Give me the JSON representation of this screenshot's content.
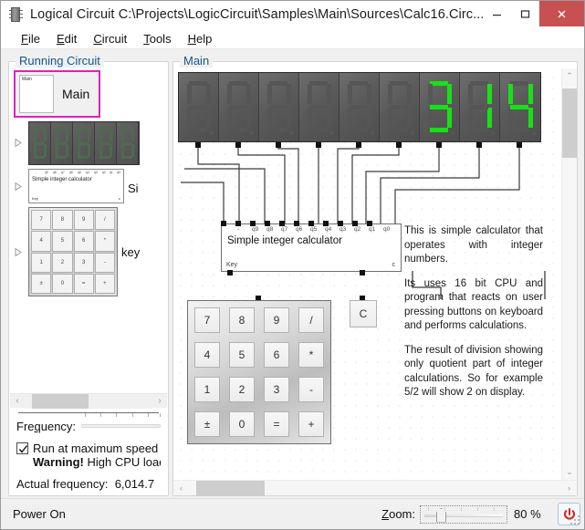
{
  "window": {
    "title": "Logical Circuit C:\\Projects\\LogicCircuit\\Samples\\Main\\Sources\\Calc16.Circ...",
    "icon": "chip-icon",
    "minimize_label": "–",
    "maximize_label": "□",
    "close_label": "×",
    "accent_close": "#c75050",
    "accent_selection": "#e020c0",
    "accent_groupbox_title": "#14568c"
  },
  "menu": {
    "items": [
      {
        "label": "File",
        "accel": "F"
      },
      {
        "label": "Edit",
        "accel": "E"
      },
      {
        "label": "Circuit",
        "accel": "C"
      },
      {
        "label": "Tools",
        "accel": "T"
      },
      {
        "label": "Help",
        "accel": "H"
      }
    ]
  },
  "sidebar": {
    "group_title": "Running Circuit",
    "items": [
      {
        "name": "Main",
        "label": "Main",
        "thumb_label": "Main",
        "selected": true,
        "expandable": false
      },
      {
        "name": "seven-segment-display",
        "label": "",
        "selected": false,
        "expandable": true
      },
      {
        "name": "simple-integer-calculator",
        "label": "Si",
        "selected": false,
        "expandable": true
      },
      {
        "name": "keypad",
        "label": "key",
        "selected": false,
        "expandable": true
      }
    ],
    "hscroll": {
      "left_arrow": "‹",
      "right_arrow": "›"
    },
    "frequency": {
      "label": "Frequency:",
      "slider_value": 100
    },
    "run_max_speed": {
      "label": "Run at maximum speed",
      "checked": true
    },
    "warning": {
      "bold": "Warning!",
      "text": "High CPU load"
    },
    "actual_frequency": {
      "label": "Actual frequency:",
      "value": "6,014.7"
    }
  },
  "canvas": {
    "group_title": "Main",
    "display": {
      "digit_count": 9,
      "value": "314",
      "on_color": "#18e018",
      "off_color": "#565656",
      "digits": [
        "",
        "",
        "",
        "",
        "",
        "",
        "3",
        "1",
        "4"
      ]
    },
    "calc_block": {
      "title": "Simple integer calculator",
      "top_pins": [
        "-",
        "q9",
        "q8",
        "q7",
        "q6",
        "q5",
        "q4",
        "q3",
        "q2",
        "q1",
        "q0"
      ],
      "bottom_left_pin": "Key",
      "bottom_right_pin": "c"
    },
    "keypad": {
      "keys": [
        "7",
        "8",
        "9",
        "/",
        "4",
        "5",
        "6",
        "*",
        "1",
        "2",
        "3",
        "-",
        "±",
        "0",
        "=",
        "+"
      ]
    },
    "clear_button": {
      "label": "C"
    },
    "notes": [
      "This is simple calculator that operates with integer numbers.",
      "Its uses 16 bit CPU and program that reacts on user pressing buttons on keyboard and performs calculations.",
      "The result of division showing only quotient part of integer calculations. So for example 5/2 will show 2 on display."
    ],
    "vscroll": {
      "up_arrow": "⌃",
      "down_arrow": "⌄"
    },
    "hscroll": {
      "left_arrow": "‹",
      "right_arrow": "›"
    }
  },
  "statusbar": {
    "power_state": "Power On",
    "zoom_label": "Zoom:",
    "zoom_accel": "Z",
    "zoom_value": "80 %",
    "zoom_percent": 80,
    "power_button": "power-icon",
    "power_color": "#e01b1b"
  }
}
